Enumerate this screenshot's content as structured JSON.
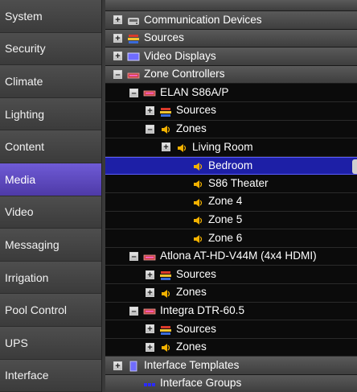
{
  "sidebar": {
    "items": [
      {
        "label": "System"
      },
      {
        "label": "Security"
      },
      {
        "label": "Climate"
      },
      {
        "label": "Lighting"
      },
      {
        "label": "Content"
      },
      {
        "label": "Media",
        "selected": true
      },
      {
        "label": "Video"
      },
      {
        "label": "Messaging"
      },
      {
        "label": "Irrigation"
      },
      {
        "label": "Pool Control"
      },
      {
        "label": "UPS"
      },
      {
        "label": "Interface"
      }
    ]
  },
  "tree": {
    "rows": [
      {
        "label": "Communication Devices",
        "level": 0,
        "toggle": "+",
        "icon": "communication-icon",
        "header": true
      },
      {
        "label": "Sources",
        "level": 0,
        "toggle": "+",
        "icon": "sources-icon",
        "header": true
      },
      {
        "label": "Video Displays",
        "level": 0,
        "toggle": "+",
        "icon": "display-icon",
        "header": true
      },
      {
        "label": "Zone Controllers",
        "level": 0,
        "toggle": "-",
        "icon": "controller-icon",
        "header": true
      },
      {
        "label": "ELAN S86A/P",
        "level": 1,
        "toggle": "-",
        "icon": "controller-icon"
      },
      {
        "label": "Sources",
        "level": 2,
        "toggle": "+",
        "icon": "sources-icon"
      },
      {
        "label": "Zones",
        "level": 2,
        "toggle": "-",
        "icon": "speaker-icon"
      },
      {
        "label": "Living Room",
        "level": 3,
        "toggle": "+",
        "icon": "speaker-icon"
      },
      {
        "label": "Bedroom",
        "level": 4,
        "toggle": "",
        "icon": "speaker-icon",
        "selected": true
      },
      {
        "label": "S86 Theater",
        "level": 4,
        "toggle": "",
        "icon": "speaker-icon"
      },
      {
        "label": "Zone 4",
        "level": 4,
        "toggle": "",
        "icon": "speaker-icon"
      },
      {
        "label": "Zone 5",
        "level": 4,
        "toggle": "",
        "icon": "speaker-icon"
      },
      {
        "label": "Zone 6",
        "level": 4,
        "toggle": "",
        "icon": "speaker-icon"
      },
      {
        "label": "Atlona AT-HD-V44M (4x4 HDMI)",
        "level": 1,
        "toggle": "-",
        "icon": "controller-icon"
      },
      {
        "label": "Sources",
        "level": 2,
        "toggle": "+",
        "icon": "sources-icon"
      },
      {
        "label": "Zones",
        "level": 2,
        "toggle": "+",
        "icon": "speaker-icon"
      },
      {
        "label": "Integra DTR-60.5",
        "level": 1,
        "toggle": "-",
        "icon": "controller-icon"
      },
      {
        "label": "Sources",
        "level": 2,
        "toggle": "+",
        "icon": "sources-icon"
      },
      {
        "label": "Zones",
        "level": 2,
        "toggle": "+",
        "icon": "speaker-icon"
      },
      {
        "label": "Interface Templates",
        "level": 0,
        "toggle": "+",
        "icon": "template-icon",
        "header": true
      },
      {
        "label": "Interface Groups",
        "level": 1,
        "toggle": "",
        "icon": "groups-icon",
        "header": true
      }
    ]
  },
  "colors": {
    "selected_nav": "#5a45c0",
    "selected_row": "#1d1fa6"
  }
}
